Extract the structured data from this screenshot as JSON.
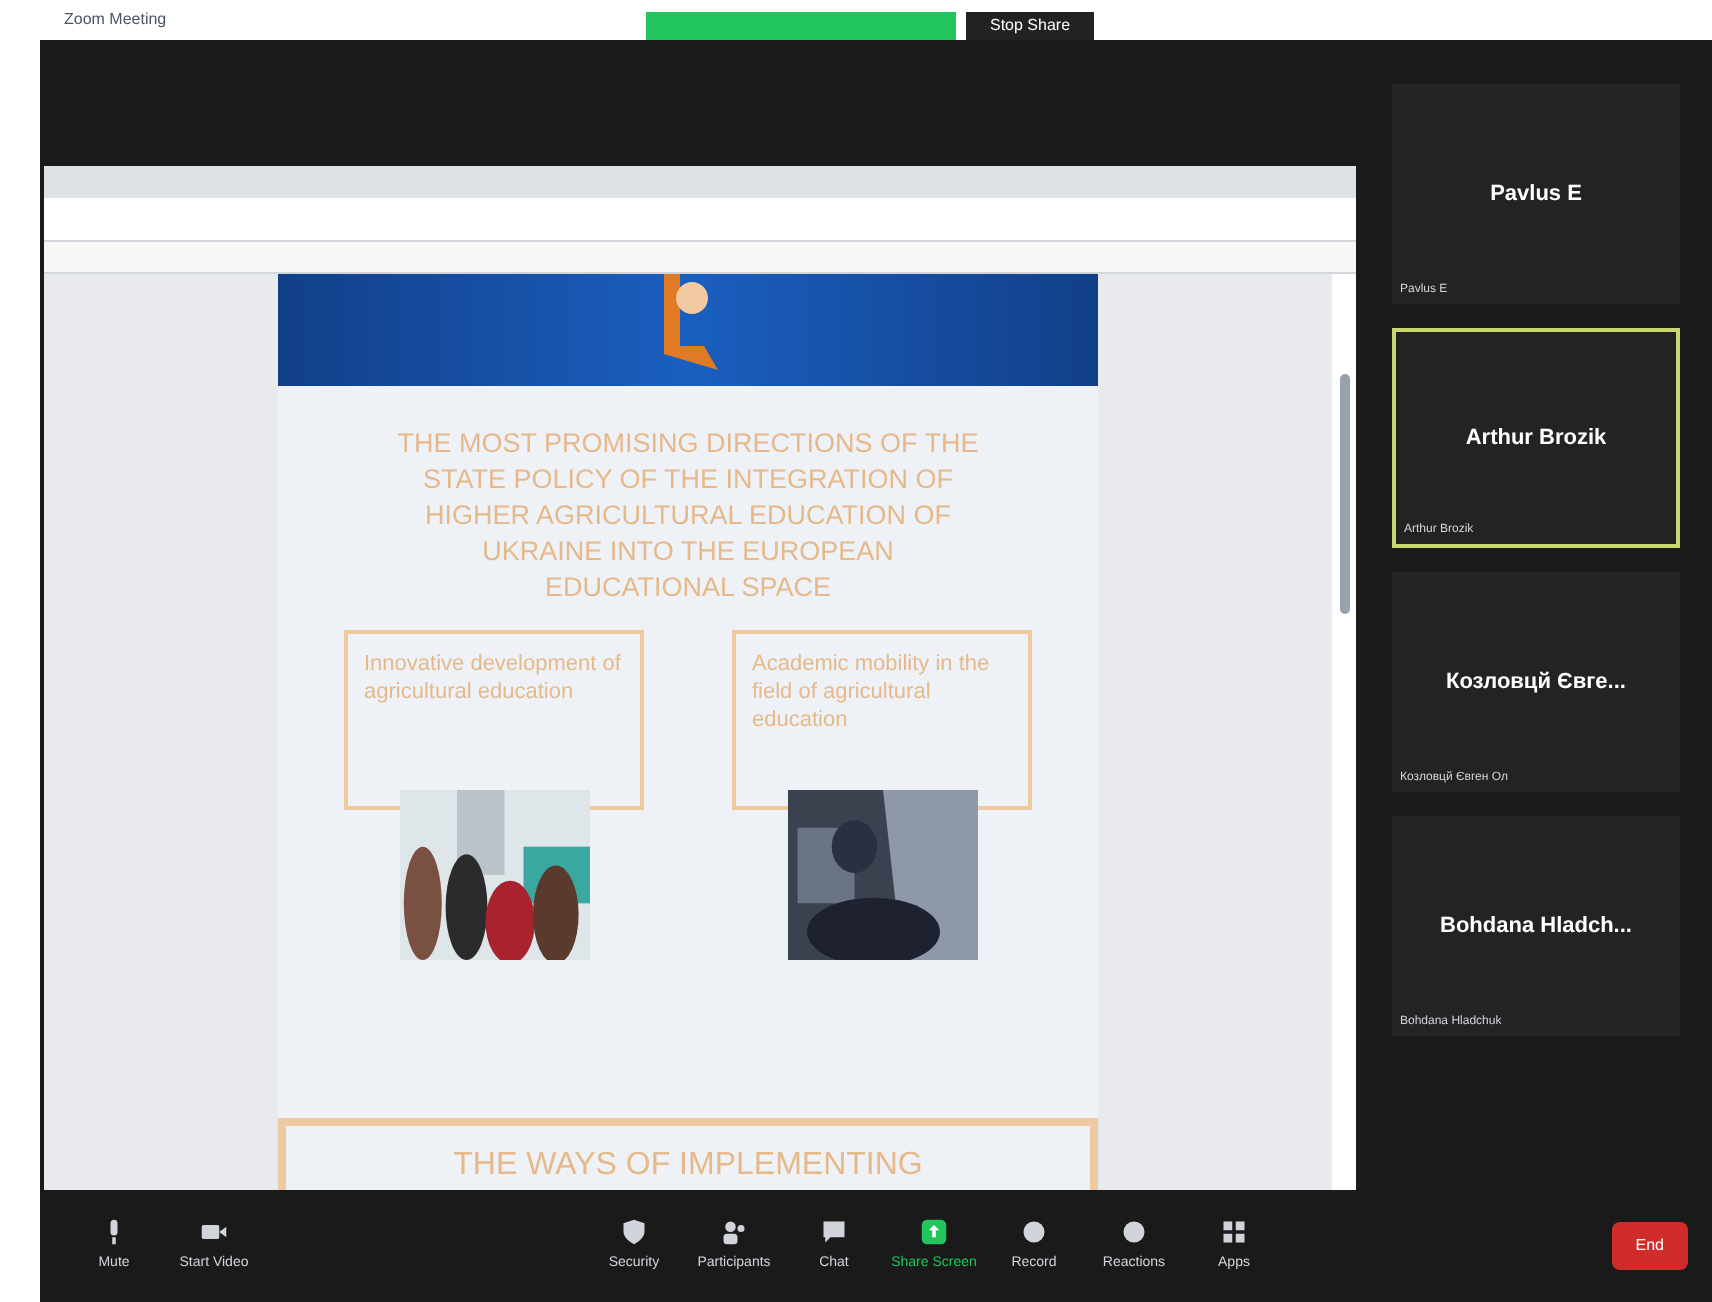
{
  "window": {
    "title": "Zoom Meeting"
  },
  "share_banner": {
    "button": "Stop Share"
  },
  "slide": {
    "title": "THE MOST PROMISING DIRECTIONS OF THE STATE POLICY OF THE INTEGRATION OF HIGHER AGRICULTURAL EDUCATION OF UKRAINE INTO THE EUROPEAN EDUCATIONAL SPACE",
    "boxes": [
      {
        "text": "Innovative development of agricultural education"
      },
      {
        "text": "Academic mobility in the field of agricultural education"
      }
    ],
    "next_heading": "THE WAYS OF IMPLEMENTING"
  },
  "participants": [
    {
      "name": "Pavlus E",
      "label": "Pavlus E",
      "speaking": false
    },
    {
      "name": "Arthur Brozik",
      "label": "Arthur Brozik",
      "speaking": true
    },
    {
      "name": "Козловцй Євге...",
      "label": "Козловцй Євген Ол",
      "speaking": false
    },
    {
      "name": "Bohdana Hladch...",
      "label": "Bohdana Hladchuk",
      "speaking": false
    }
  ],
  "toolbar": [
    {
      "label": "Mute",
      "kind": "mic",
      "active": false
    },
    {
      "label": "Start Video",
      "kind": "video",
      "active": false
    },
    {
      "label": "Security",
      "kind": "shield",
      "active": false
    },
    {
      "label": "Participants",
      "kind": "people",
      "active": false
    },
    {
      "label": "Chat",
      "kind": "chat",
      "active": false
    },
    {
      "label": "Share Screen",
      "kind": "share",
      "active": true
    },
    {
      "label": "Record",
      "kind": "record",
      "active": false
    },
    {
      "label": "Reactions",
      "kind": "smile",
      "active": false
    },
    {
      "label": "Apps",
      "kind": "apps",
      "active": false
    }
  ],
  "end_button": "End"
}
